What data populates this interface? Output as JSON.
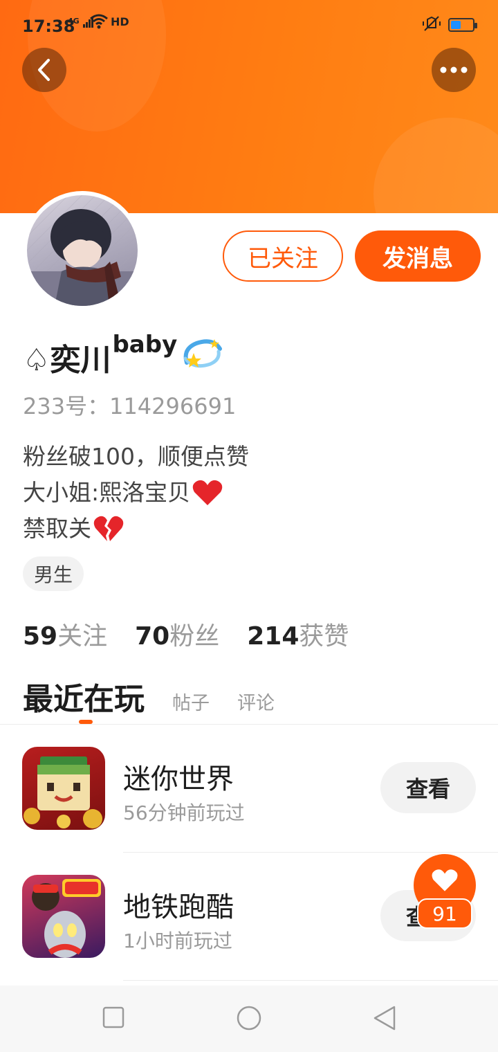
{
  "status_bar": {
    "time": "17:38",
    "network": "4G",
    "hd": "HD",
    "battery_level": 0.45
  },
  "profile": {
    "name": "♤奕川",
    "name_sup": "baby",
    "id_line": "233号：114296691",
    "bio": [
      "粉丝破100，顺便点赞",
      "大小姐:熙洛宝贝",
      "禁取关"
    ],
    "gender_tag": "男生",
    "follow_button": "已关注",
    "message_button": "发消息"
  },
  "stats": [
    {
      "num": "59",
      "label": "关注"
    },
    {
      "num": "70",
      "label": "粉丝"
    },
    {
      "num": "214",
      "label": "获赞"
    }
  ],
  "tabs": {
    "active": "最近在玩",
    "others": [
      "帖子",
      "评论"
    ]
  },
  "games": [
    {
      "name": "迷你世界",
      "time": "56分钟前玩过",
      "button": "查看"
    },
    {
      "name": "地铁跑酷",
      "time": "1小时前玩过",
      "button": "查看"
    }
  ],
  "float_like": {
    "count": "91"
  },
  "colors": {
    "accent": "#ff5a0a",
    "header": "#ff7d12"
  },
  "icons": [
    "back-arrow-icon",
    "more-dots-icon",
    "heart-icon",
    "broken-heart-icon",
    "sparkle-icon",
    "square-nav-icon",
    "circle-nav-icon",
    "triangle-nav-icon"
  ]
}
